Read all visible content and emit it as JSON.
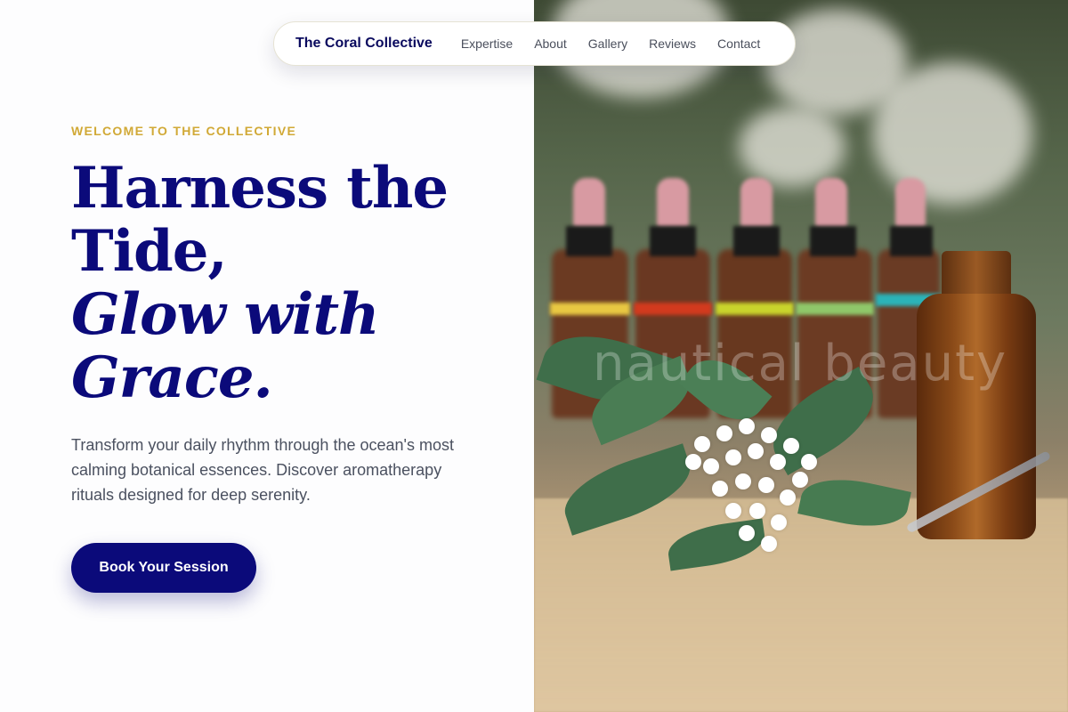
{
  "nav": {
    "brand": "The Coral Collective",
    "links": [
      "Expertise",
      "About",
      "Gallery",
      "Reviews",
      "Contact"
    ]
  },
  "hero": {
    "eyebrow": "WELCOME TO THE COLLECTIVE",
    "headline_line1": "Harness the",
    "headline_line2": "Tide,",
    "headline_line3": "Glow with",
    "headline_line4": "Grace.",
    "subtext": "Transform your daily rhythm through the ocean's most calming botanical essences. Discover aromatherapy rituals designed for deep serenity.",
    "cta_label": "Book Your Session"
  },
  "image": {
    "watermark": "nautical beauty"
  },
  "colors": {
    "brand_navy": "#0b0a7a",
    "accent_gold": "#d1a936",
    "body_text": "#4b5160"
  }
}
